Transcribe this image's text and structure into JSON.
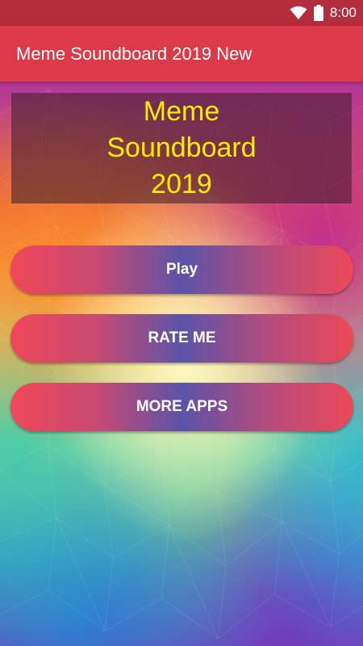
{
  "status_bar": {
    "time": "8:00",
    "icons": [
      "wifi-icon",
      "battery-icon"
    ]
  },
  "app_bar": {
    "title": "Meme Soundboard 2019 New"
  },
  "title_card": {
    "text": "Meme\nSoundboard\n2019"
  },
  "buttons": {
    "play": "Play",
    "rate": "RATE ME",
    "more": "MORE APPS"
  },
  "colors": {
    "status_bar": "#b32d3c",
    "app_bar": "#dc3a48",
    "title_text": "#ffee00",
    "button_edge": "#ef4858",
    "button_center": "#5c53a8"
  }
}
